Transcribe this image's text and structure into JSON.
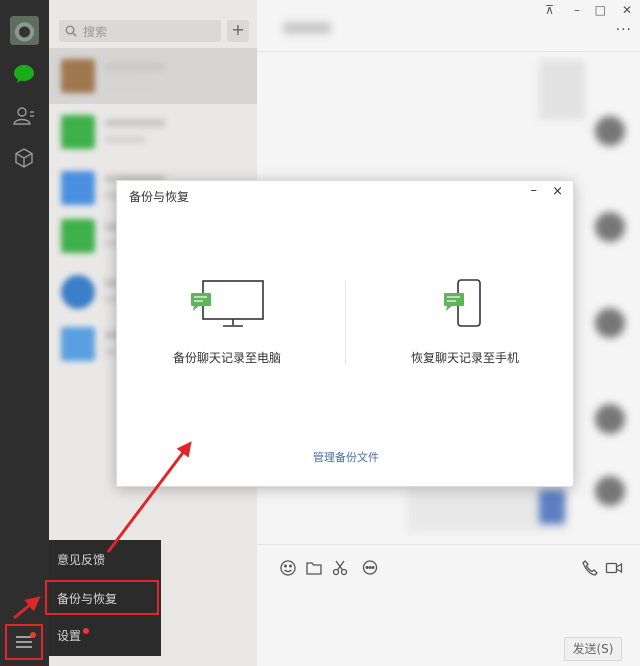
{
  "search": {
    "placeholder": "搜索"
  },
  "list": {
    "add_label": "+"
  },
  "window": {
    "pin_label": "⊼",
    "min_label": "–",
    "max_label": "□",
    "close_label": "✕",
    "more_label": "···"
  },
  "composer": {
    "send_label": "发送(S)"
  },
  "menu": {
    "items": [
      {
        "label": "意见反馈"
      },
      {
        "label": "备份与恢复"
      },
      {
        "label": "设置"
      }
    ]
  },
  "dialog": {
    "title": "备份与恢复",
    "min_label": "–",
    "close_label": "×",
    "option_backup": "备份聊天记录至电脑",
    "option_restore": "恢复聊天记录至手机",
    "manage_link": "管理备份文件"
  },
  "colors": {
    "rail": "#2e2e2e",
    "accent_green": "#1aad19",
    "highlight_red": "#e0262a",
    "link_blue": "#4a6ea0"
  },
  "icons": [
    "chat-icon",
    "contacts-icon",
    "favorites-icon",
    "menu-icon",
    "search-icon",
    "emoji-icon",
    "folder-icon",
    "scissors-icon",
    "chat-bubble-icon",
    "phone-icon",
    "video-icon",
    "computer-icon",
    "phone-device-icon"
  ]
}
